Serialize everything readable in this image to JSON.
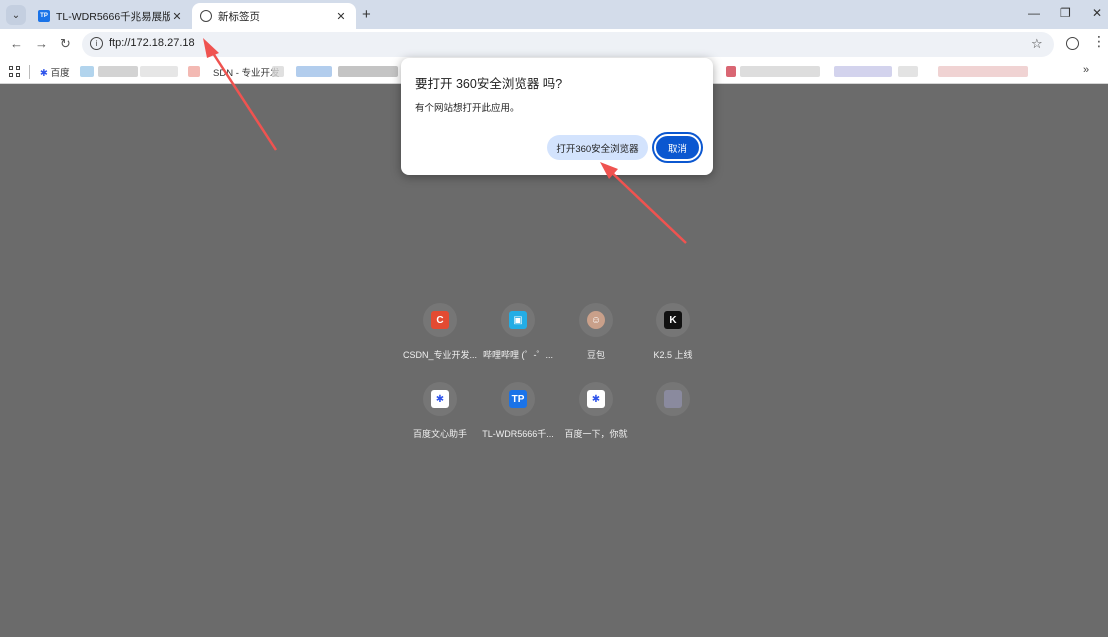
{
  "tabs": [
    {
      "title": "TL-WDR5666千兆易展版",
      "favicon": "TP",
      "active": false
    },
    {
      "title": "新标签页",
      "active": true
    }
  ],
  "address": {
    "url": "ftp://172.18.27.18"
  },
  "bookmarks": {
    "baidu_label": "百度",
    "csdn_label": "SDN - 专业开发"
  },
  "dialog": {
    "title": "要打开 360安全浏览器 吗?",
    "message": "有个网站想打开此应用。",
    "open_button": "打开360安全浏览器",
    "cancel_button": "取消"
  },
  "shortcuts": [
    {
      "label": "CSDN_专业开发...",
      "icon": "csdn-icon",
      "glyph": "C",
      "color": "#e34b32"
    },
    {
      "label": "哔哩哔哩 (゜-゜...",
      "icon": "bilibili-icon",
      "glyph": "▣",
      "color": "#23ade5"
    },
    {
      "label": "豆包",
      "icon": "doubao-icon",
      "glyph": "☺",
      "color": "#c9a08a"
    },
    {
      "label": "K2.5 上线",
      "icon": "kimi-icon",
      "glyph": "K",
      "color": "#111111"
    },
    {
      "label": "百度文心助手",
      "icon": "baidu-paw-icon",
      "glyph": "✱",
      "color": "#2f54eb"
    },
    {
      "label": "TL-WDR5666千...",
      "icon": "tp-link-icon",
      "glyph": "TP",
      "color": "#1a73e8"
    },
    {
      "label": "百度一下，你就",
      "icon": "baidu-paw-icon",
      "glyph": "✱",
      "color": "#2f54eb"
    },
    {
      "label": "",
      "icon": "blurred-icon",
      "glyph": "",
      "color": "#8a8a9e"
    }
  ],
  "colors": {
    "accent": "#0b57d0",
    "annotation_arrow": "#ef5350",
    "backdrop": "#6b6b6b"
  }
}
